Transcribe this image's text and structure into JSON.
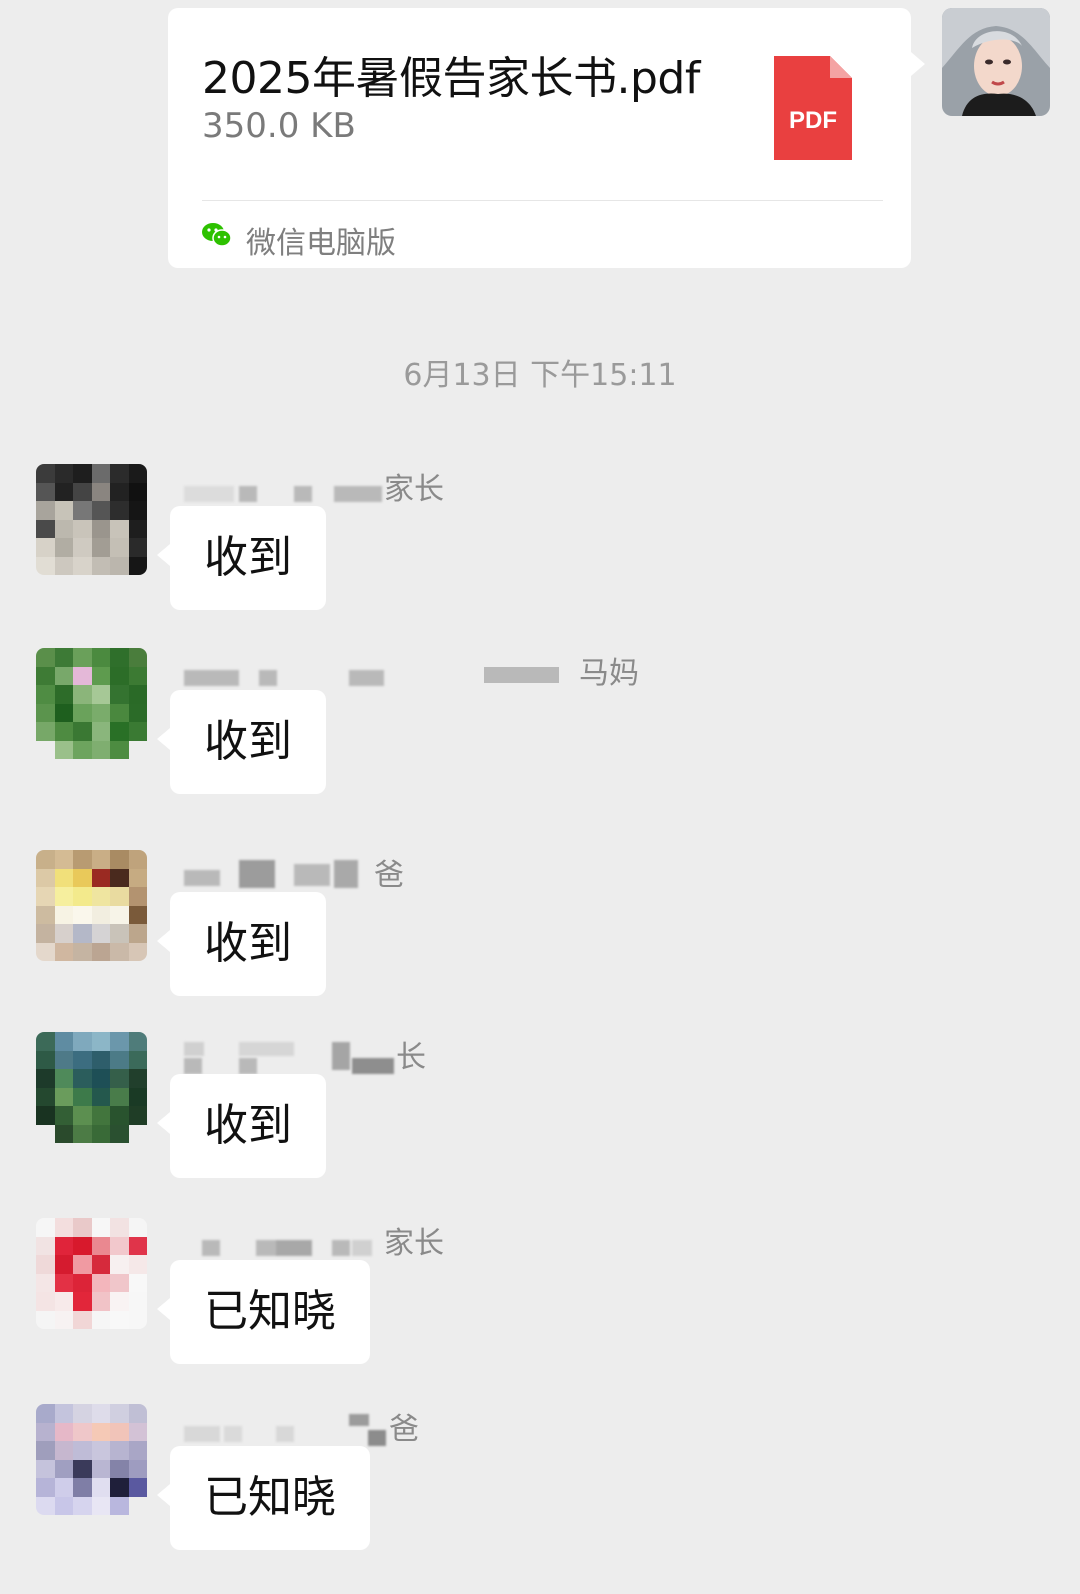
{
  "file_message": {
    "file_name": "2025年暑假告家长书.pdf",
    "file_size": "350.0 KB",
    "file_type_label": "PDF",
    "source": "微信电脑版",
    "icon": "pdf-file-icon",
    "accent": "#e94040"
  },
  "timestamp": "6月13日 下午15:11",
  "messages": [
    {
      "sender_suffix": "家长",
      "text": "收到"
    },
    {
      "sender_suffix": "马妈",
      "text": "收到"
    },
    {
      "sender_suffix": "爸",
      "text": "收到"
    },
    {
      "sender_suffix": "长",
      "text": "收到"
    },
    {
      "sender_suffix": "家长",
      "text": "已知晓"
    },
    {
      "sender_suffix": "爸",
      "text": "已知晓"
    }
  ]
}
